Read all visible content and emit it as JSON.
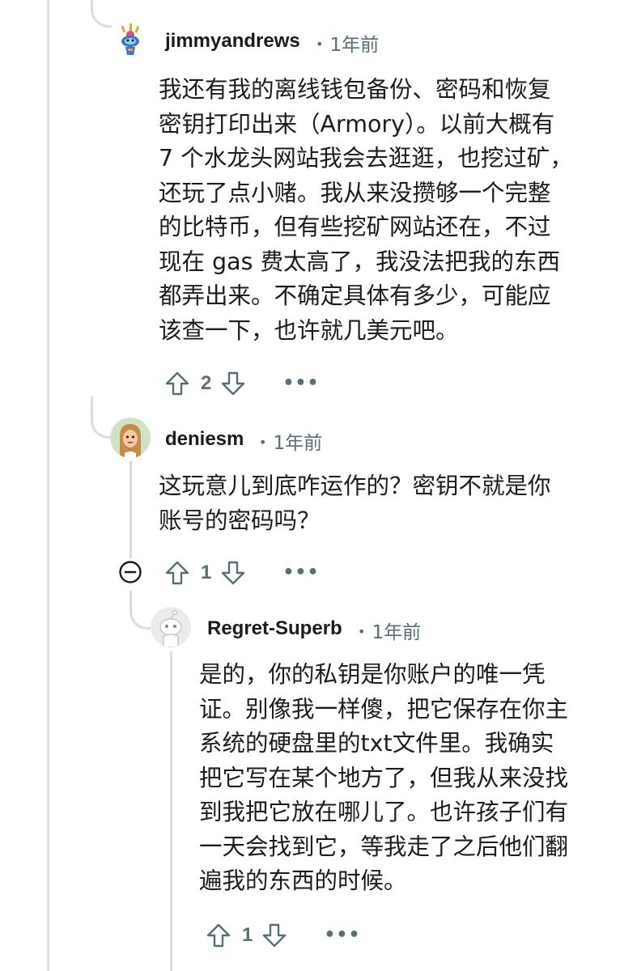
{
  "comments": [
    {
      "author": "jimmyandrews",
      "time": "1年前",
      "lines": [
        "我还有我的离线钱包备份、密码和恢复",
        "密钥打印出来（Armory）。以前大概有",
        "7 个水龙头网站我会去逛逛，也挖过矿，",
        "还玩了点小赌。我从来没攒够一个完整",
        "的比特币，但有些挖矿网站还在，不过",
        "现在 gas 费太高了，我没法把我的东西",
        "都弄出来。不确定具体有多少，可能应",
        "该查一下，也许就几美元吧。"
      ],
      "score": "2",
      "more": "•••"
    },
    {
      "author": "deniesm",
      "time": "1年前",
      "lines": [
        "这玩意儿到底咋运作的？密钥不就是你",
        "账号的密码吗？"
      ],
      "score": "1",
      "more": "•••"
    },
    {
      "author": "Regret-Superb",
      "time": "1年前",
      "lines": [
        "是的，你的私钥是你账户的唯一凭",
        "证。别像我一样傻，把它保存在你主",
        "系统的硬盘里的txt文件里。我确实",
        "把它写在某个地方了，但我从来没找",
        "到我把它放在哪儿了。也许孩子们有",
        "一天会找到它，等我走了之后他们翻",
        "遍我的东西的时候。"
      ],
      "score": "1",
      "more": "•••"
    }
  ],
  "meta_separator": "•",
  "icons": {
    "upvote": "arrow-up-outline-icon",
    "downvote": "arrow-down-outline-icon",
    "collapse": "minus-circle-icon"
  },
  "colors": {
    "text": "#1c1c1c",
    "meta": "#576f76",
    "thread_line": "#d9dde0"
  }
}
